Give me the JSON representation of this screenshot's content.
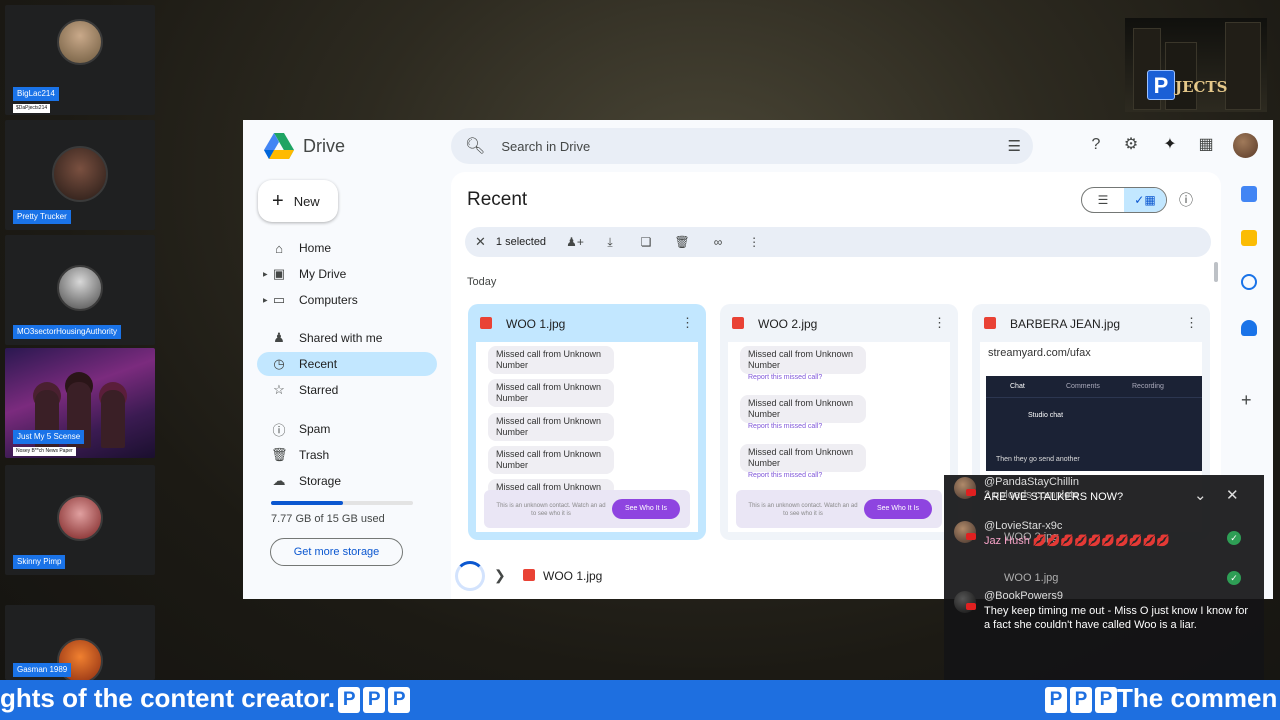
{
  "participants": [
    {
      "name": "BigLac214",
      "sub": "$DaPjects214",
      "avatar_color": "#8a7a5a"
    },
    {
      "name": "Pretty Trucker",
      "sub": "",
      "avatar_color": "#3a2a22"
    },
    {
      "name": "MO3sectorHousingAuthority",
      "sub": "",
      "avatar_color": "#9a9a9a"
    },
    {
      "name": "Just My 5 Scense",
      "sub": "Nosey B**ch News Paper",
      "avatar_color": "#7b2b7e"
    },
    {
      "name": "Skinny Pimp",
      "sub": "",
      "avatar_color": "#c06060"
    },
    {
      "name": "Gasman 1989",
      "sub": "",
      "avatar_color": "#e05a20"
    }
  ],
  "logo": {
    "letter": "P",
    "word": "JECTS"
  },
  "drive": {
    "app_name": "Drive",
    "search_placeholder": "Search in Drive",
    "new_label": "New",
    "nav": {
      "home": "Home",
      "my_drive": "My Drive",
      "computers": "Computers",
      "shared": "Shared with me",
      "recent": "Recent",
      "starred": "Starred",
      "spam": "Spam",
      "trash": "Trash",
      "storage": "Storage"
    },
    "storage_used_fraction": 0.51,
    "storage_text": "7.77 GB of 15 GB used",
    "get_storage_label": "Get more storage",
    "page_title": "Recent",
    "selection_count": "1 selected",
    "section_today": "Today",
    "files": [
      {
        "name": "WOO 1.jpg"
      },
      {
        "name": "WOO 2.jpg"
      },
      {
        "name": "BARBERA JEAN.jpg"
      }
    ],
    "thumb": {
      "missed_call": "Missed call from Unknown Number",
      "missed_call_short": "Missed call from Unknown",
      "report": "Report this missed call?",
      "unknown_contact": "This is an unknown contact. Watch an ad to see who it is",
      "see_who": "See Who It Is",
      "sy_url": "streamyard.com/ufax",
      "sy_chat": "Chat",
      "sy_comments": "Comments",
      "sy_recording": "Recording",
      "sy_studio": "Studio chat",
      "sy_line": "Then they go send another"
    },
    "upload_file": "WOO 1.jpg"
  },
  "chat": {
    "messages": [
      {
        "user": "@PandaStayChillin",
        "text": "ARE WE STALKERS NOW?"
      },
      {
        "user": "@LovieStar-x9c",
        "text": "Jaz Hush 💋💋💋💋💋💋💋💋💋💋"
      },
      {
        "user": "@BookPowers9",
        "text": "They keep timing me out - Miss O just know I know for a fact she couldn't have called Woo is a liar."
      }
    ],
    "ghost_uploads": "2 uploads complete",
    "ghost_file_a": "WOO 2.jpg",
    "ghost_file_b": "WOO 1.jpg"
  },
  "ticker": {
    "left_text": "ghts of the content creator.",
    "right_text": "The commen",
    "badge": "P"
  }
}
